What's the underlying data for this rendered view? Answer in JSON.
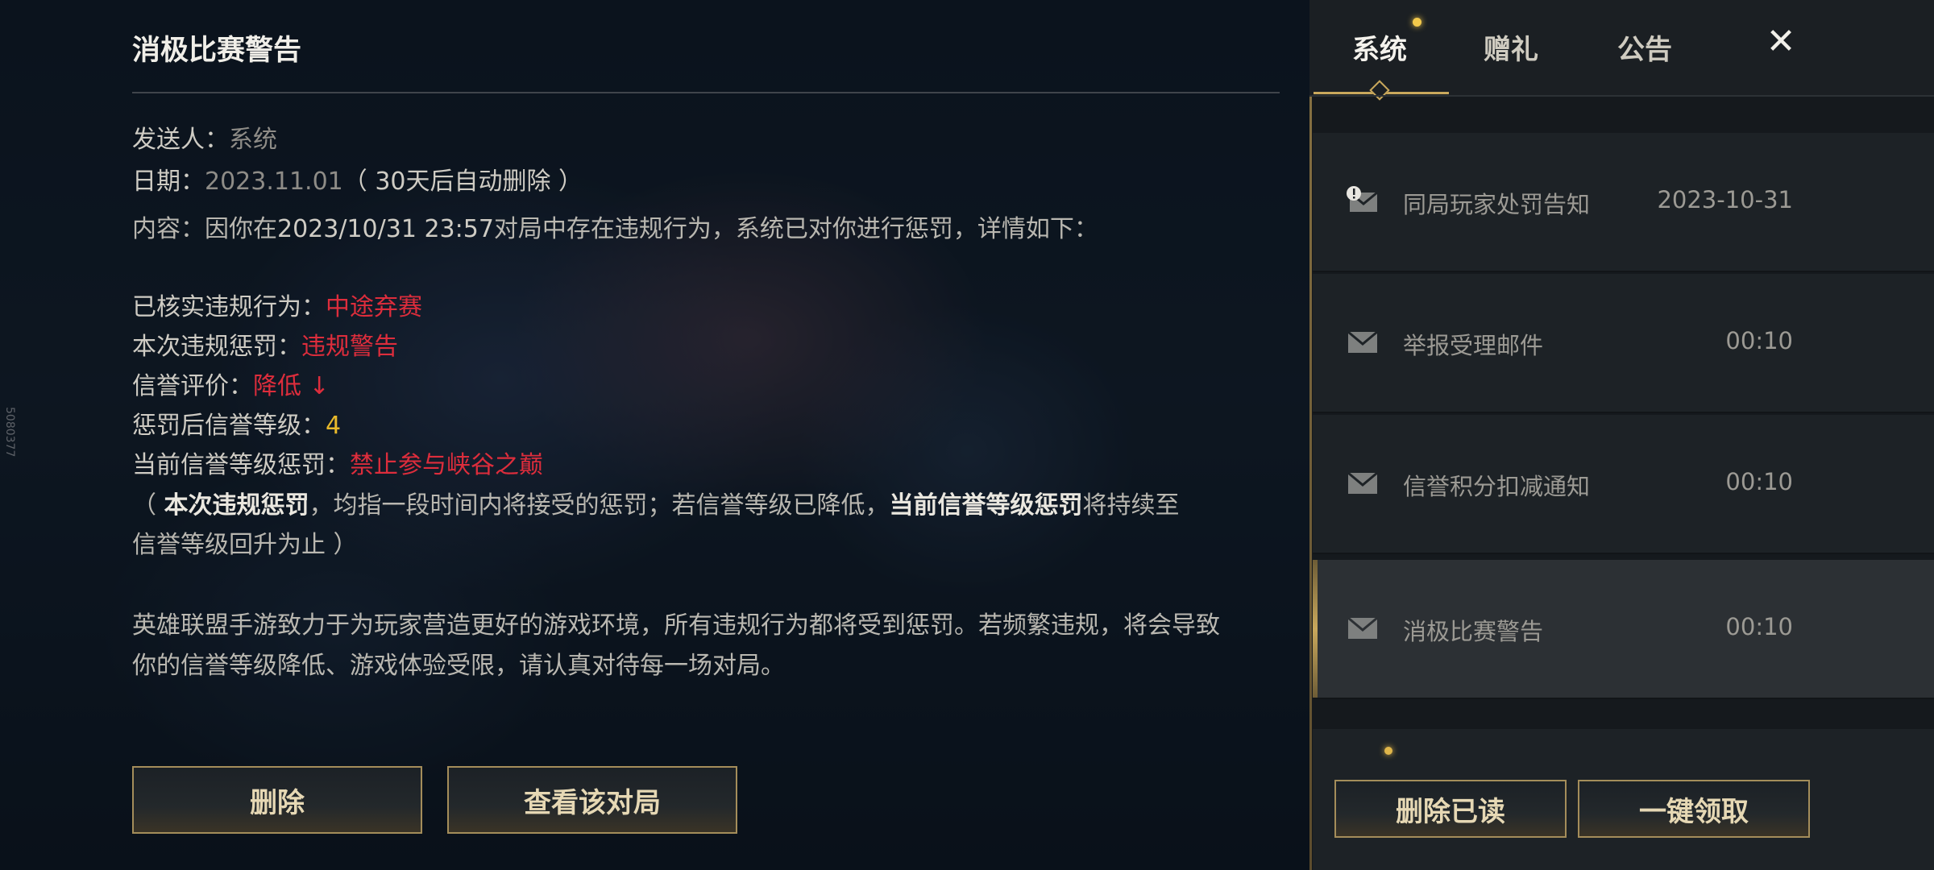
{
  "side_id": "5080377",
  "detail": {
    "title": "消极比赛警告",
    "sender_label": "发送人：",
    "sender": "系统",
    "date_label": "日期：",
    "date": "2023.11.01",
    "date_note": "（ 30天后自动删除 ）",
    "content_label": "内容：",
    "content_pre": "因你在",
    "content_time": "2023/10/31 23:57",
    "content_post": "对局中存在违规行为，系统已对你进行惩罚，详情如下：",
    "violation_label": "已核实违规行为：",
    "violation": "中途弃赛",
    "penalty_label": "本次违规惩罚：",
    "penalty": "违规警告",
    "credit_label": "信誉评价：",
    "credit": "降低",
    "credit_arrow": "↓",
    "level_label": "惩罚后信誉等级：",
    "level": "4",
    "level_penalty_label": "当前信誉等级惩罚：",
    "level_penalty": "禁止参与峡谷之巅",
    "note_open": "（ ",
    "note_b1": "本次违规惩罚",
    "note_mid": "，均指一段时间内将接受的惩罚；若信誉等级已降低，",
    "note_b2": "当前信誉等级惩罚",
    "note_end": "将持续至",
    "note_line2": "信誉等级回升为止 ）",
    "footer": "英雄联盟手游致力于为玩家营造更好的游戏环境，所有违规行为都将受到惩罚。若频繁违规，将会导致你的信誉等级降低、游戏体验受限，请认真对待每一场对局。",
    "delete_button": "删除",
    "view_match_button": "查看该对局"
  },
  "panel": {
    "tabs": [
      {
        "label": "系统",
        "active": true,
        "dot": true
      },
      {
        "label": "赠礼",
        "active": false
      },
      {
        "label": "公告",
        "active": false
      }
    ],
    "close_icon": "close-icon",
    "mails": [
      {
        "title": "同局玩家处罚告知",
        "time": "2023-10-31",
        "icon": "alert-mail-icon",
        "selected": false
      },
      {
        "title": "举报受理邮件",
        "time": "00:10",
        "icon": "mail-icon",
        "selected": false
      },
      {
        "title": "信誉积分扣减通知",
        "time": "00:10",
        "icon": "mail-icon",
        "selected": false
      },
      {
        "title": "消极比赛警告",
        "time": "00:10",
        "icon": "mail-icon",
        "selected": true
      }
    ],
    "delete_read_button": "删除已读",
    "claim_all_button": "一键领取"
  },
  "colors": {
    "accent_gold": "#c9a85c",
    "red": "#dd2d3c",
    "level_gold": "#e8b92b"
  }
}
